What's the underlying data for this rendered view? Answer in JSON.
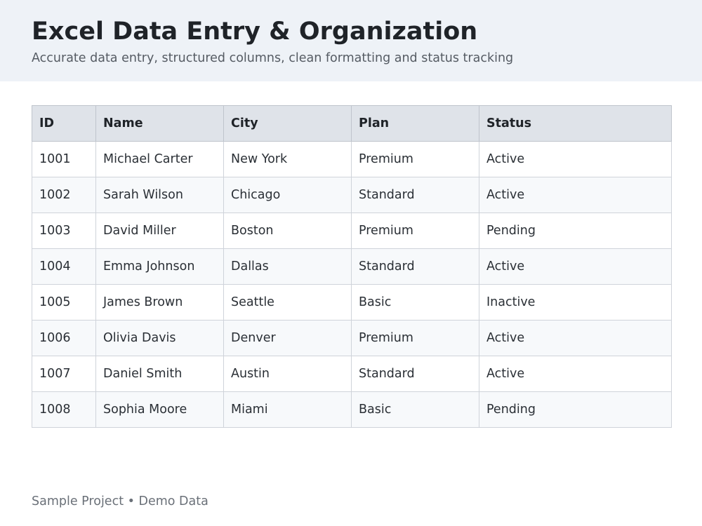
{
  "header": {
    "title": "Excel Data Entry & Organization",
    "subtitle": "Accurate data entry, structured columns, clean formatting and status tracking"
  },
  "table": {
    "columns": [
      "ID",
      "Name",
      "City",
      "Plan",
      "Status"
    ],
    "rows": [
      [
        "1001",
        "Michael Carter",
        "New York",
        "Premium",
        "Active"
      ],
      [
        "1002",
        "Sarah Wilson",
        "Chicago",
        "Standard",
        "Active"
      ],
      [
        "1003",
        "David Miller",
        "Boston",
        "Premium",
        "Pending"
      ],
      [
        "1004",
        "Emma Johnson",
        "Dallas",
        "Standard",
        "Active"
      ],
      [
        "1005",
        "James Brown",
        "Seattle",
        "Basic",
        "Inactive"
      ],
      [
        "1006",
        "Olivia Davis",
        "Denver",
        "Premium",
        "Active"
      ],
      [
        "1007",
        "Daniel Smith",
        "Austin",
        "Standard",
        "Active"
      ],
      [
        "1008",
        "Sophia Moore",
        "Miami",
        "Basic",
        "Pending"
      ]
    ]
  },
  "footer": {
    "text": "Sample Project • Demo Data"
  }
}
